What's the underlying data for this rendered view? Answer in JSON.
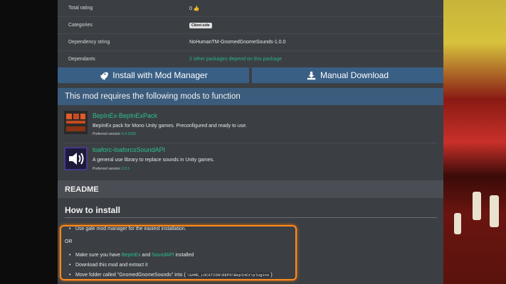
{
  "info": {
    "rows": [
      {
        "key": "Total rating",
        "value": "0"
      },
      {
        "key": "Categories",
        "value": "Client-side"
      },
      {
        "key": "Dependency string",
        "value": "NoHumanTM-GnomedGnomeSounds-1.0.0"
      },
      {
        "key": "Dependants",
        "value": "2 other packages depend on this package"
      }
    ]
  },
  "buttons": {
    "install": "Install with Mod Manager",
    "download": "Manual Download"
  },
  "requirements": {
    "header": "This mod requires the following mods to function",
    "preferred_label": "Preferred version:",
    "mods": [
      {
        "name": "BepInEx-BepInExPack",
        "desc": "BepInEx pack for Mono Unity games. Preconfigured and ready to use.",
        "version": "5.4.2100"
      },
      {
        "name": "loaforc-loaforcsSoundAPI",
        "desc": "A general use library to replace sounds in Unity games.",
        "version": "2.0.1"
      }
    ]
  },
  "readme": {
    "header": "README",
    "title": "How to install",
    "line1": "Use gale mod manager for the easiest installation.",
    "or": "OR",
    "line2_pre": "Make sure you have",
    "line2_link1": "BepInEx",
    "line2_mid": "and",
    "line2_link2": "SoundAPI",
    "line2_post": "installed",
    "line3": "Download this mod and extract it",
    "line4_pre": "Move folder called \"GnomedGnomeSounds\" into (",
    "line4_code": "\\GAME_LOCATION\\REPO\\BepInEx\\plugins",
    "line4_post": ")"
  },
  "colors": {
    "accent_green": "#2bc08f",
    "button_blue": "#3a5f85",
    "highlight": "#ff8a1e"
  }
}
